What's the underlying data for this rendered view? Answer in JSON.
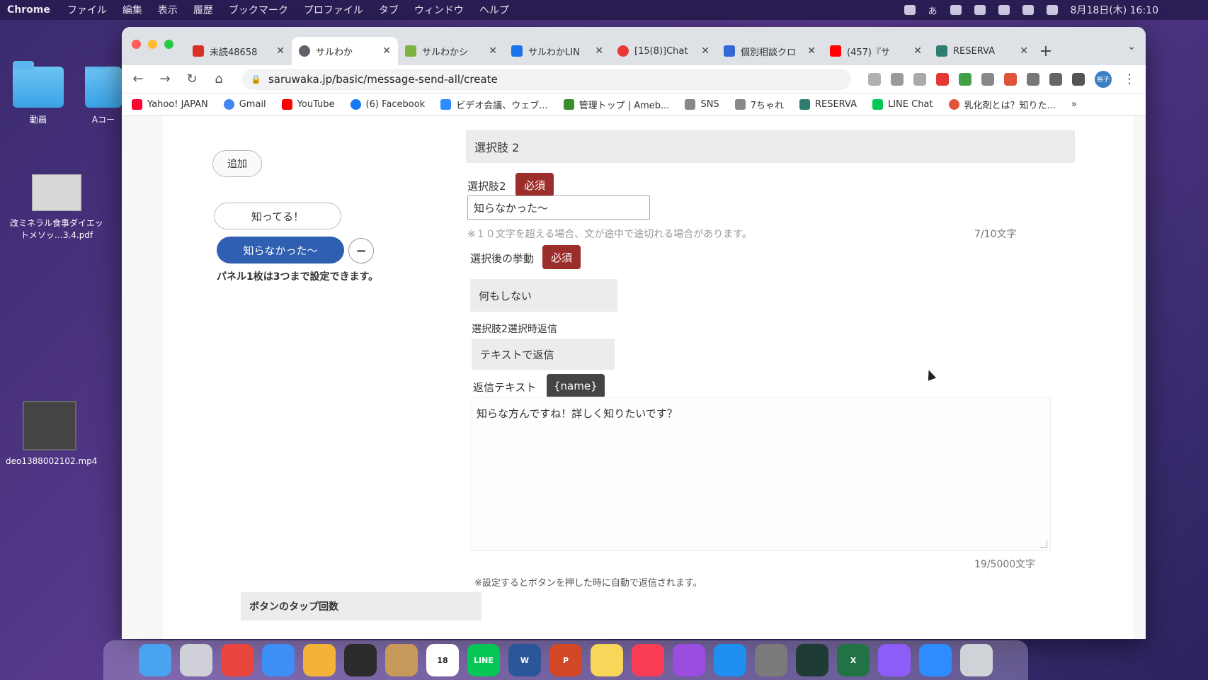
{
  "menubar": {
    "app_name": "Chrome",
    "items": [
      "ファイル",
      "編集",
      "表示",
      "履歴",
      "ブックマーク",
      "プロファイル",
      "タブ",
      "ウィンドウ",
      "ヘルプ"
    ],
    "ime": "あ",
    "clock": "8月18日(木) 16:10"
  },
  "desktop": {
    "icons": [
      {
        "label": "動画"
      },
      {
        "label": "Aコー"
      },
      {
        "label": "改ミネラル食事ダイエットメソッ…3.4.pdf"
      },
      {
        "label": "deo1388002102.mp4"
      }
    ]
  },
  "tabs": [
    {
      "label": "未読48658",
      "color": "#d93025"
    },
    {
      "label": "サルわか",
      "color": "#5f6368",
      "active": true
    },
    {
      "label": "サルわかシ",
      "color": "#7cb342"
    },
    {
      "label": "サルわかLIN",
      "color": "#1a73e8"
    },
    {
      "label": "[15(8)]Chat",
      "color": "#e53935"
    },
    {
      "label": "個別相談クロ",
      "color": "#3367d6"
    },
    {
      "label": "(457)『サ",
      "color": "#ff0000"
    },
    {
      "label": "RESERVA",
      "color": "#2e7d6e"
    }
  ],
  "toolbar": {
    "url": "saruwaka.jp/basic/message-send-all/create",
    "profile_label": "裕子"
  },
  "bookmarks": [
    {
      "label": "Yahoo! JAPAN",
      "color": "#ff0033"
    },
    {
      "label": "Gmail",
      "color": "#4285f4"
    },
    {
      "label": "YouTube",
      "color": "#ff0000"
    },
    {
      "label": "(6) Facebook",
      "color": "#1877f2"
    },
    {
      "label": "ビデオ会議、ウェブ...",
      "color": "#2d8cff"
    },
    {
      "label": "管理トップ | Ameb...",
      "color": "#3c8d2f"
    },
    {
      "label": "SNS",
      "color": "#888888"
    },
    {
      "label": "7ちゃれ",
      "color": "#888888"
    },
    {
      "label": "RESERVA",
      "color": "#2e7d6e"
    },
    {
      "label": "LINE Chat",
      "color": "#06c755"
    },
    {
      "label": "乳化剤とは？知りた...",
      "color": "#e0533d"
    }
  ],
  "left_panel": {
    "add_label": "追加",
    "choice_1": "知ってる！",
    "choice_2": "知らなかった〜",
    "minus": "−",
    "note": "パネル1枚は3つまで設定できます。"
  },
  "form": {
    "section_title": "選択肢 2",
    "choice_label": "選択肢2",
    "required": "必須",
    "choice_value": "知らなかった〜",
    "hint": "※１０文字を超える場合、文が途中で途切れる場合があります。",
    "choice_counter": "7/10文字",
    "action_label": "選択後の挙動",
    "action_value": "何もしない",
    "reply_label": "選択肢2選択時返信",
    "reply_value": "テキストで返信",
    "reply_text_label": "返信テキスト",
    "name_tag": "{name}",
    "reply_text": "知らな方んですね！詳しく知りたいです？",
    "reply_counter": "19/5000文字",
    "auto_note": "※設定するとボタンを押した時に自動で返信されます。",
    "tap_count_title": "ボタンのタップ回数"
  },
  "dock": {
    "apps": [
      {
        "name": "finder",
        "color": "#4aa3f0"
      },
      {
        "name": "launchpad",
        "color": "#d0d0d8"
      },
      {
        "name": "chrome",
        "color": "#e8453c"
      },
      {
        "name": "mail",
        "color": "#3d8ef5"
      },
      {
        "name": "photos",
        "color": "#f3b23a"
      },
      {
        "name": "obs",
        "color": "#2b2b2b"
      },
      {
        "name": "contacts",
        "color": "#c79a5c"
      },
      {
        "name": "calendar",
        "color": "#ffffff",
        "text": "18"
      },
      {
        "name": "line",
        "color": "#06c755",
        "text": "LINE"
      },
      {
        "name": "word",
        "color": "#2b579a",
        "text": "W"
      },
      {
        "name": "powerpoint",
        "color": "#d24726",
        "text": "P"
      },
      {
        "name": "notes",
        "color": "#f8d65a"
      },
      {
        "name": "music",
        "color": "#fa3c55"
      },
      {
        "name": "podcasts",
        "color": "#9b4de0"
      },
      {
        "name": "app-store",
        "color": "#1f8ef1"
      },
      {
        "name": "system-preferences",
        "color": "#7a7a7a"
      },
      {
        "name": "filmora",
        "color": "#1f3b35"
      },
      {
        "name": "excel",
        "color": "#217346",
        "text": "X"
      },
      {
        "name": "messenger",
        "color": "#8e5cf7"
      },
      {
        "name": "zoom",
        "color": "#2d8cff"
      },
      {
        "name": "trash",
        "color": "#cfd3d8"
      }
    ]
  }
}
